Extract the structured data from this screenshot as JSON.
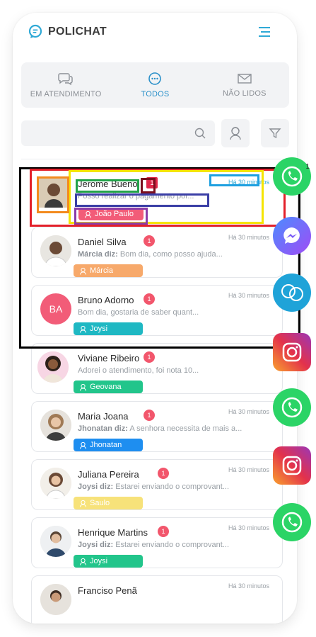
{
  "app": {
    "title": "POLICHAT"
  },
  "tabs": [
    {
      "label": "EM ATENDIMENTO",
      "icon": "chat-bubbles-icon",
      "active": false
    },
    {
      "label": "TODOS",
      "icon": "chat-dots-icon",
      "active": true
    },
    {
      "label": "NÃO LIDOS",
      "icon": "envelope-icon",
      "active": false
    }
  ],
  "search": {
    "placeholder": ""
  },
  "conversations": [
    {
      "name": "Jerome Bueno",
      "badge": "1",
      "time": "Há 30 minutos",
      "author": "",
      "message": "Posso realizar o pagamento por...",
      "agent": "João Paulo",
      "agent_color": "#f25c78",
      "avatar": "photo"
    },
    {
      "name": "Daniel Silva",
      "badge": "1",
      "time": "Há 30 minutos",
      "author": "Márcia diz:",
      "message": "Bom dia, como posso ajuda...",
      "agent": "Márcia",
      "agent_color": "#f7a96b",
      "avatar": "photo"
    },
    {
      "name": "Bruno Adorno",
      "badge": "1",
      "time": "Há 30 minutos",
      "author": "",
      "message": "Bom dia, gostaria de saber quant...",
      "agent": "Joysi",
      "agent_color": "#1fb8c3",
      "avatar": "BA"
    },
    {
      "name": "Viviane Ribeiro",
      "badge": "1",
      "time": "",
      "author": "",
      "message": "Adorei o atendimento, foi nota 10...",
      "agent": "Geovana",
      "agent_color": "#22c58b",
      "avatar": "photo"
    },
    {
      "name": "Maria Joana",
      "badge": "1",
      "time": "Há 30 minutos",
      "author": "Jhonatan diz:",
      "message": "A senhora necessita de mais a...",
      "agent": "Jhonatan",
      "agent_color": "#1e8ef0",
      "avatar": "photo"
    },
    {
      "name": "Juliana Pereira",
      "badge": "1",
      "time": "Há 30 minutos",
      "author": "Joysi diz:",
      "message": "Estarei enviando o comprovant...",
      "agent": "Saulo",
      "agent_color": "#f7e27a",
      "avatar": "photo"
    },
    {
      "name": "Henrique Martins",
      "badge": "1",
      "time": "Há 30 minutos",
      "author": "Joysi diz:",
      "message": "Estarei enviando o comprovant...",
      "agent": "Joysi",
      "agent_color": "#22c58b",
      "avatar": "photo"
    },
    {
      "name": "Franciso Penã",
      "badge": "",
      "time": "Há 30 minutos",
      "author": "",
      "message": "",
      "agent": "",
      "agent_color": "#ffffff",
      "avatar": "photo"
    }
  ],
  "channels": [
    {
      "icon": "whatsapp-icon",
      "color": "#25d366",
      "badge": "1"
    },
    {
      "icon": "messenger-icon",
      "color": "#7b5cf6"
    },
    {
      "icon": "chat-bubbles-icon",
      "color": "#1fa3d8"
    },
    {
      "icon": "instagram-icon",
      "color": "#d62976"
    },
    {
      "icon": "whatsapp-icon",
      "color": "#25d366"
    },
    {
      "icon": "instagram-icon",
      "color": "#d62976"
    },
    {
      "icon": "whatsapp-icon",
      "color": "#25d366"
    }
  ]
}
